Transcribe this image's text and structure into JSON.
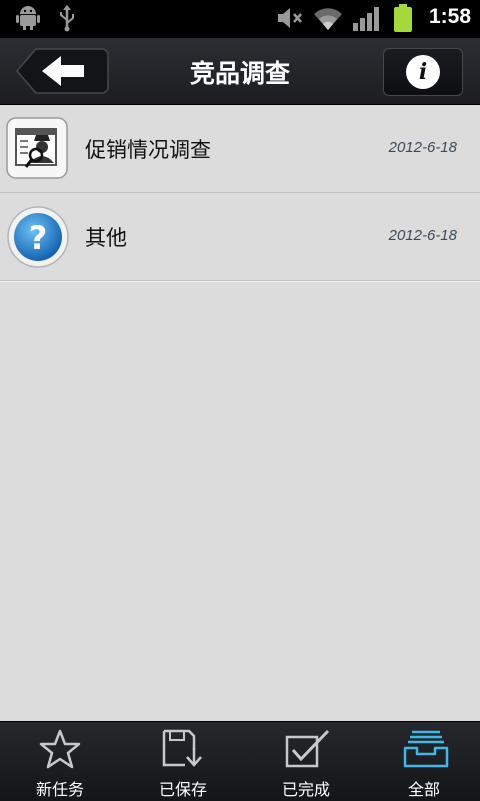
{
  "status_bar": {
    "time": "1:58",
    "icons": [
      "android-debug-icon",
      "usb-icon",
      "mute-icon",
      "wifi-icon",
      "signal-icon",
      "battery-icon"
    ]
  },
  "header": {
    "title": "竞品调查",
    "back_icon": "back-arrow-icon",
    "info_icon": "info-icon"
  },
  "list": {
    "items": [
      {
        "label": "促销情况调查",
        "date": "2012-6-18",
        "icon": "promotion-survey-icon"
      },
      {
        "label": "其他",
        "date": "2012-6-18",
        "icon": "question-icon"
      }
    ]
  },
  "tabs": [
    {
      "label": "新任务",
      "icon": "star-icon"
    },
    {
      "label": "已保存",
      "icon": "save-icon"
    },
    {
      "label": "已完成",
      "icon": "completed-check-icon"
    },
    {
      "label": "全部",
      "icon": "inbox-icon",
      "active": true
    }
  ],
  "colors": {
    "accent": "#3fb8e8",
    "battery": "#a4d93a",
    "title_bar": "#24272b",
    "background": "#dcdcdc"
  }
}
